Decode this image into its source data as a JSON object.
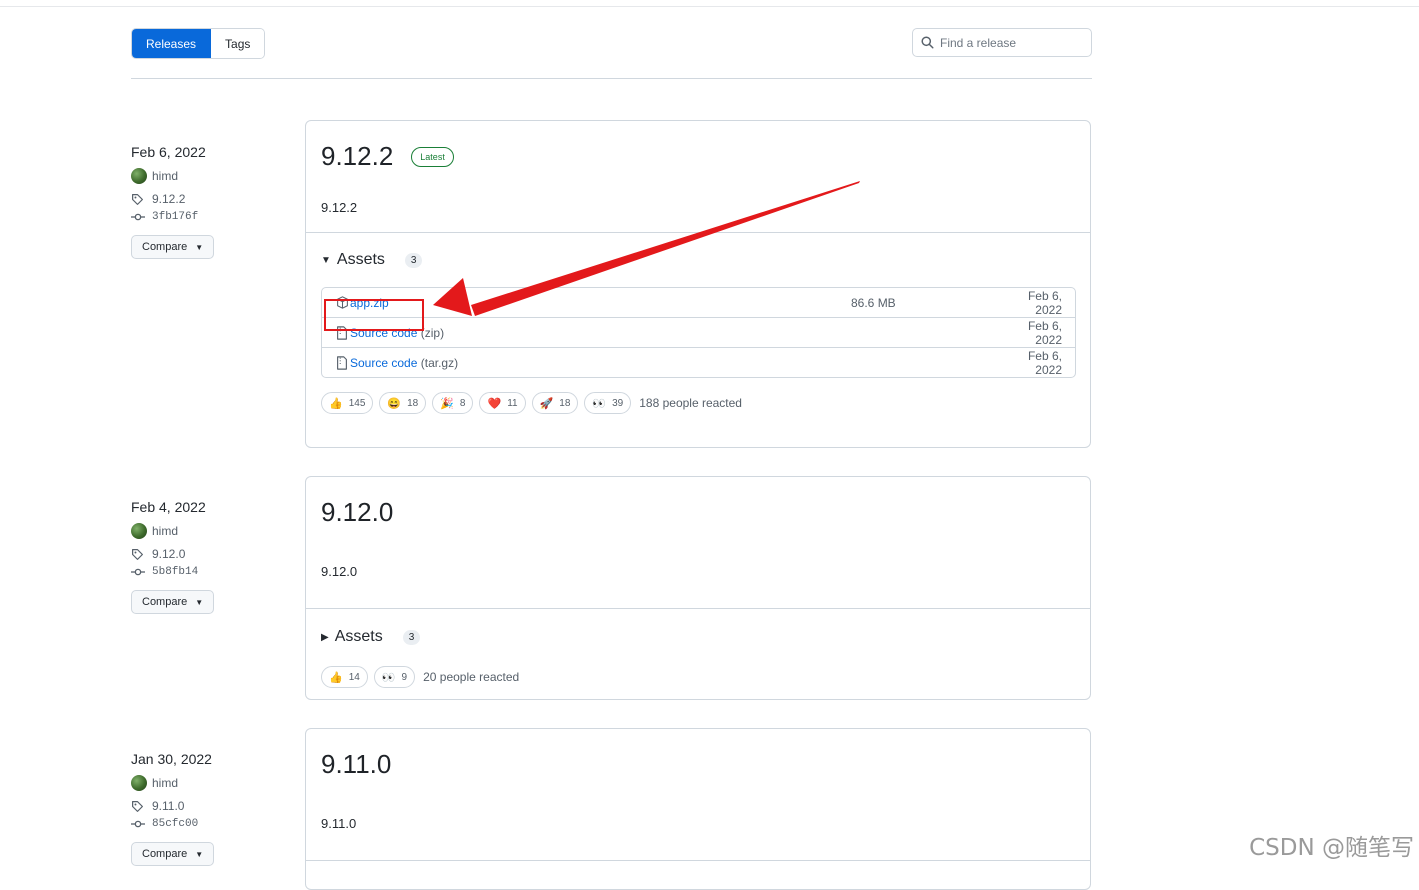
{
  "nav": {
    "tabs": [
      {
        "label": "Releases",
        "active": true
      },
      {
        "label": "Tags",
        "active": false
      }
    ],
    "search_placeholder": "Find a release"
  },
  "releases": [
    {
      "date": "Feb 6, 2022",
      "author": "himd",
      "tag": "9.12.2",
      "commit": "3fb176f",
      "compare_label": "Compare",
      "title": "9.12.2",
      "latest_label": "Latest",
      "description": "9.12.2",
      "assets_label": "Assets",
      "assets_count": "3",
      "assets_expanded": true,
      "assets": [
        {
          "name": "app.zip",
          "suffix": "",
          "size": "86.6 MB",
          "date": "Feb 6, 2022",
          "icon": "package-icon"
        },
        {
          "name": "Source code",
          "suffix": "(zip)",
          "size": "",
          "date": "Feb 6, 2022",
          "icon": "file-zip-icon"
        },
        {
          "name": "Source code",
          "suffix": "(tar.gz)",
          "size": "",
          "date": "Feb 6, 2022",
          "icon": "file-zip-icon"
        }
      ],
      "reactions": [
        {
          "emoji": "👍",
          "count": "145"
        },
        {
          "emoji": "😄",
          "count": "18"
        },
        {
          "emoji": "🎉",
          "count": "8"
        },
        {
          "emoji": "❤️",
          "count": "11"
        },
        {
          "emoji": "🚀",
          "count": "18"
        },
        {
          "emoji": "👀",
          "count": "39"
        }
      ],
      "reacted_text": "188 people reacted"
    },
    {
      "date": "Feb 4, 2022",
      "author": "himd",
      "tag": "9.12.0",
      "commit": "5b8fb14",
      "compare_label": "Compare",
      "title": "9.12.0",
      "description": "9.12.0",
      "assets_label": "Assets",
      "assets_count": "3",
      "assets_expanded": false,
      "reactions": [
        {
          "emoji": "👍",
          "count": "14"
        },
        {
          "emoji": "👀",
          "count": "9"
        }
      ],
      "reacted_text": "20 people reacted"
    },
    {
      "date": "Jan 30, 2022",
      "author": "himd",
      "tag": "9.11.0",
      "commit": "85cfc00",
      "compare_label": "Compare",
      "title": "9.11.0",
      "description": "9.11.0"
    }
  ],
  "annotation": {
    "box_color": "#e3191b",
    "arrow_color": "#e3191b"
  },
  "watermark": "CSDN @随笔写",
  "colors": {
    "accent": "#0969da",
    "latest": "#1a7f37",
    "border": "#d0d7de"
  }
}
